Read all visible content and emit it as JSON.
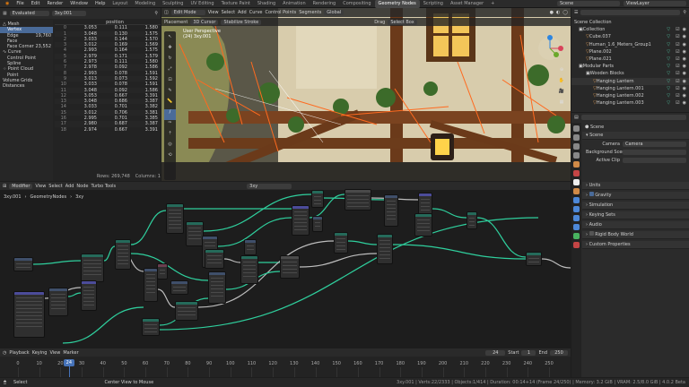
{
  "menu": [
    "File",
    "Edit",
    "Render",
    "Window",
    "Help"
  ],
  "workspaces": [
    "Layout",
    "Modeling",
    "Sculpting",
    "UV Editing",
    "Texture Paint",
    "Shading",
    "Animation",
    "Rendering",
    "Compositing",
    "Geometry Nodes",
    "Scripting",
    "Asset Manager"
  ],
  "active_workspace": "Geometry Nodes",
  "scene_field": "Scene",
  "view_layer_field": "ViewLayer",
  "spreadsheet": {
    "mode": "Evaluated",
    "object": "3xy.001",
    "column_header": "position",
    "tree": [
      "Mesh",
      "Vertex",
      "Edge",
      "Face",
      "Face Corner",
      "Curve",
      "Control Point",
      "Spline",
      "Point Cloud",
      "Point",
      "Volume Grids",
      "Distances"
    ],
    "counts": [
      "",
      "",
      "19,760",
      "",
      "23,552",
      "",
      "",
      "",
      "",
      "",
      "",
      ""
    ],
    "rows": [
      [
        "0",
        "3.053",
        "0.111",
        "1.580"
      ],
      [
        "1",
        "3.048",
        "0.130",
        "1.575"
      ],
      [
        "2",
        "3.033",
        "0.144",
        "1.570"
      ],
      [
        "3",
        "3.012",
        "0.169",
        "1.569"
      ],
      [
        "4",
        "2.993",
        "0.164",
        "1.575"
      ],
      [
        "5",
        "2.979",
        "0.171",
        "1.579"
      ],
      [
        "6",
        "2.973",
        "0.111",
        "1.580"
      ],
      [
        "7",
        "2.978",
        "0.092",
        "1.586"
      ],
      [
        "8",
        "2.993",
        "0.078",
        "1.591"
      ],
      [
        "9",
        "3.013",
        "0.073",
        "1.592"
      ],
      [
        "10",
        "3.033",
        "0.078",
        "1.591"
      ],
      [
        "11",
        "3.048",
        "0.092",
        "1.586"
      ],
      [
        "12",
        "3.053",
        "0.667",
        "3.391"
      ],
      [
        "13",
        "3.048",
        "0.686",
        "3.387"
      ],
      [
        "14",
        "3.033",
        "0.701",
        "3.382"
      ],
      [
        "15",
        "3.012",
        "0.706",
        "3.381"
      ],
      [
        "16",
        "2.995",
        "0.701",
        "3.385"
      ],
      [
        "17",
        "2.980",
        "0.687",
        "3.387"
      ],
      [
        "18",
        "2.974",
        "0.667",
        "3.391"
      ]
    ],
    "footer_rows": "Rows: 269,748",
    "footer_cols": "Columns: 1"
  },
  "viewport": {
    "mode": "Edit Mode",
    "menus": [
      "View",
      "Select",
      "Add",
      "Curve",
      "Control Points",
      "Segments"
    ],
    "global": "Global",
    "placement_row": [
      "Placement",
      "3D Cursor",
      "Stabilize Stroke"
    ],
    "drag_label": "Drag",
    "select_box": "Select Box",
    "overlay_title": "User Perspective",
    "overlay_sub": "(24) 3xy.001"
  },
  "outliner": {
    "title": "Scene Collection",
    "items": [
      "Collection",
      "Cube.037",
      "Human_1.6_Meters_Group1",
      "Plane.002",
      "Plane.021",
      "Modular Parts",
      "Wooden Blocks",
      "Hanging Lantern",
      "Hanging Lantern.001",
      "Hanging Lantern.002",
      "Hanging Lantern.003"
    ]
  },
  "properties": {
    "scene_name": "Scene",
    "section": "Scene",
    "camera_label": "Camera",
    "camera_value": "Camera",
    "bg_label": "Background Scene",
    "clip_label": "Active Clip",
    "panels": [
      "Units",
      "Gravity",
      "Simulation",
      "Keying Sets",
      "Audio",
      "Rigid Body World",
      "Custom Properties"
    ]
  },
  "node_editor": {
    "header": [
      "Modifier",
      "View",
      "Select",
      "Add",
      "Node",
      "Turbo Tools"
    ],
    "tree_name": "3xy",
    "breadcrumb": [
      "3xy.001",
      "GeometryNodes",
      "3xy"
    ]
  },
  "timeline": {
    "menus": [
      "Playback",
      "Keying",
      "View",
      "Marker"
    ],
    "current": "24",
    "start_label": "Start",
    "start": "1",
    "end_label": "End",
    "end": "250",
    "ticks": [
      "0",
      "10",
      "20",
      "30",
      "40",
      "50",
      "60",
      "70",
      "80",
      "90",
      "100",
      "110",
      "120",
      "130",
      "140",
      "150",
      "160",
      "170",
      "180",
      "190",
      "200",
      "210",
      "220",
      "230",
      "240",
      "250"
    ]
  },
  "statusbar": {
    "left": "Select",
    "center": "Center View to Mouse",
    "right": "3xy.001 | Verts:22/2333 | Objects:1/414 | Duration: 00:14+14 (Frame 24/250) | Memory: 3.2 GiB | VRAM: 2.5/8.0 GiB | 4.0.2 Beta"
  },
  "colors": {
    "accent": "#4a6b99",
    "active_frame": "#4673b9",
    "node_link": "#2fcf9d",
    "geometry_header": "#256a5a",
    "vector_header": "#4c4c9a",
    "float_header": "#3f4f6a"
  }
}
